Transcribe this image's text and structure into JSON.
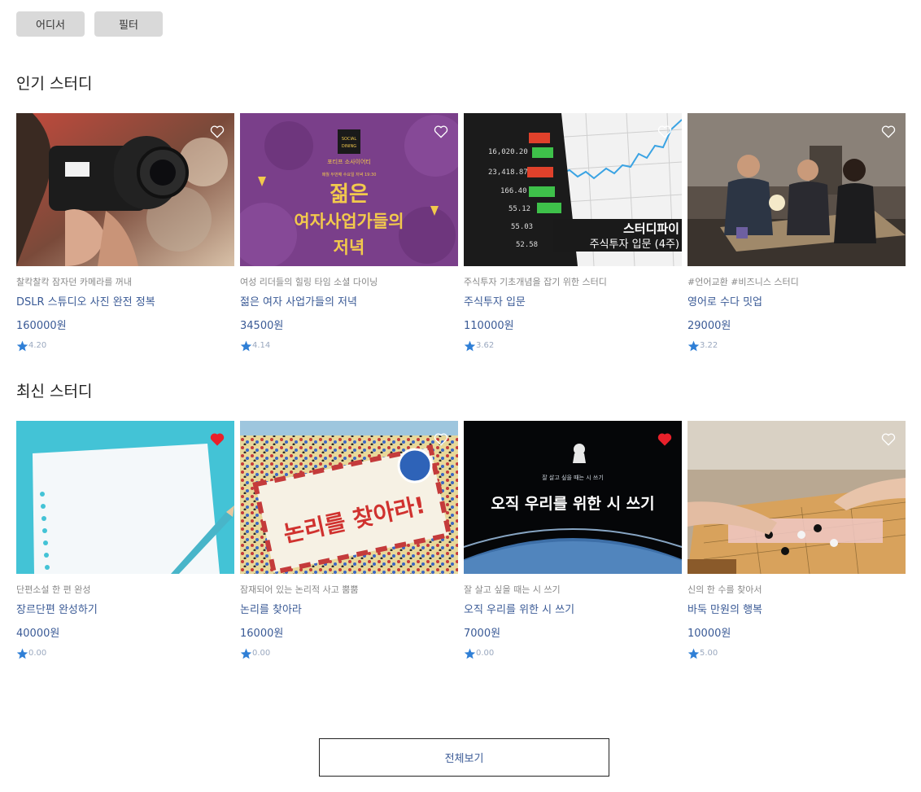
{
  "top_buttons": {
    "where": "어디서",
    "filter": "필터"
  },
  "sections": {
    "popular": {
      "title": "인기 스터디",
      "cards": [
        {
          "subtitle": "찰칵찰칵 잠자던 카메라를 꺼내",
          "title": "DSLR 스튜디오 사진 완전 정복",
          "price": "160000원",
          "rating": "4.20",
          "liked": false,
          "image": "camera-photo"
        },
        {
          "subtitle": "여성 리더들의 힐링 타임 소셜 다이닝",
          "title": "젊은 여자 사업가들의 저녁",
          "price": "34500원",
          "rating": "4.14",
          "liked": false,
          "image": "social-dining-poster",
          "image_text": {
            "badge1": "SOCIAL",
            "badge2": "DINING",
            "line1": "포티프 소사이어티",
            "line2": "매월 두번째 수요일 저녁 19:30",
            "headline1": "젊은",
            "headline2": "여자사업가들의",
            "headline3": "저녁"
          }
        },
        {
          "subtitle": "주식투자 기초개념을 잡기 위한 스터디",
          "title": "주식투자 입문",
          "price": "110000원",
          "rating": "3.62",
          "liked": false,
          "image": "stock-phone",
          "image_text": {
            "line1": "스터디파이",
            "line2": "주식투자 입문 (4주)"
          }
        },
        {
          "subtitle": "#언어교환 #비즈니스 스터디",
          "title": "영어로 수다 밋업",
          "price": "29000원",
          "rating": "3.22",
          "liked": false,
          "image": "meeting-room"
        }
      ]
    },
    "recent": {
      "title": "최신 스터디",
      "cards": [
        {
          "subtitle": "단편소설 한 편 완성",
          "title": "장르단편 완성하기",
          "price": "40000원",
          "rating": "0.00",
          "liked": true,
          "image": "paper-pencil"
        },
        {
          "subtitle": "잠재되어 있는 논리적 사고 뿜뿜",
          "title": "논리를 찾아라",
          "price": "16000원",
          "rating": "0.00",
          "liked": false,
          "image": "wheres-wally-envelope",
          "image_text": {
            "headline": "논리를 찾아라!"
          }
        },
        {
          "subtitle": "잘 살고 싶을 때는 시 쓰기",
          "title": "오직 우리를 위한 시 쓰기",
          "price": "7000원",
          "rating": "0.00",
          "liked": true,
          "image": "earth-space",
          "image_text": {
            "small": "잘 살고 싶을 때는 시 쓰기",
            "headline": "오직 우리를 위한 시 쓰기"
          }
        },
        {
          "subtitle": "신의 한 수를 찾아서",
          "title": "바둑 만원의 행복",
          "price": "10000원",
          "rating": "5.00",
          "liked": false,
          "image": "baduk-board"
        }
      ]
    }
  },
  "view_all_label": "전체보기",
  "colors": {
    "accent": "#3a5a96",
    "star": "#2f7fd6",
    "heart_liked": "#e8202a",
    "chip_bg": "#d9d9d9"
  },
  "icons": {
    "heart": "heart-icon",
    "star": "star-icon"
  }
}
